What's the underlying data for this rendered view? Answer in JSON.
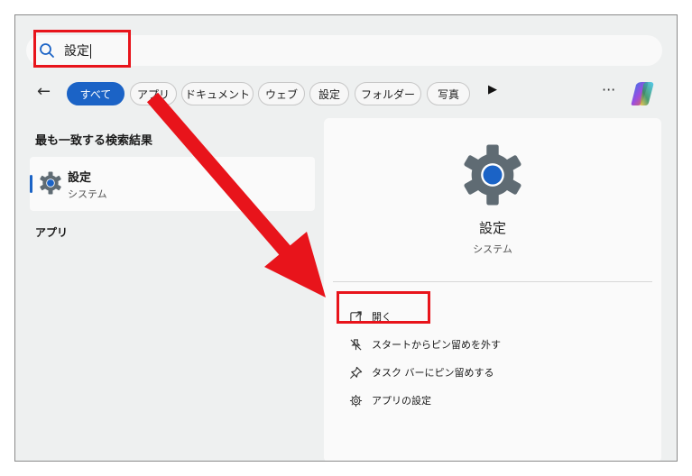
{
  "search": {
    "query": "設定"
  },
  "filters": {
    "back_icon": "back-arrow-icon",
    "chips": [
      "すべて",
      "アプリ",
      "ドキュメント",
      "ウェブ",
      "設定",
      "フォルダー",
      "写真"
    ],
    "more_label": "···"
  },
  "results": {
    "best_match_label": "最も一致する検索結果",
    "best_match": {
      "title": "設定",
      "subtitle": "システム"
    },
    "apps_label": "アプリ"
  },
  "detail": {
    "title": "設定",
    "subtitle": "システム",
    "actions": [
      "開く",
      "スタートからピン留めを外す",
      "タスク バーにピン留めする",
      "アプリの設定"
    ]
  },
  "colors": {
    "accent": "#1b63c6",
    "highlight": "#e8141b",
    "gear": "#5f6b73"
  }
}
